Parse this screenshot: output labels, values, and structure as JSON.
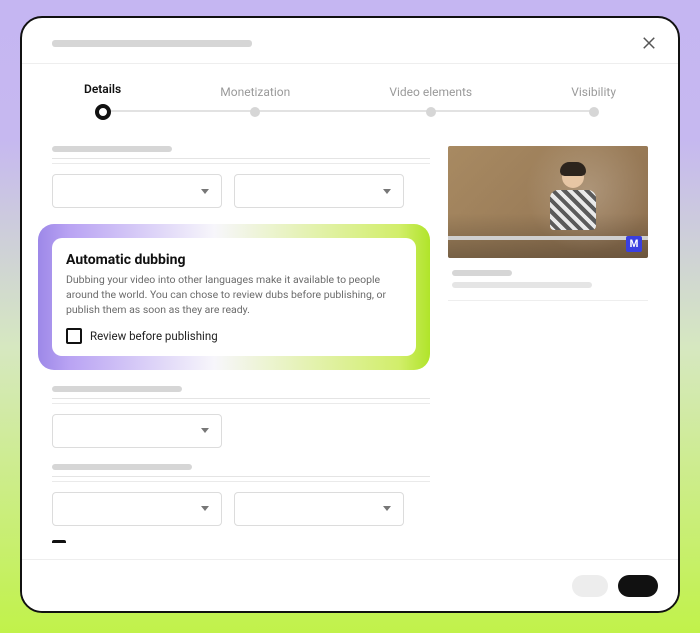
{
  "stepper": {
    "steps": [
      {
        "label": "Details",
        "active": true
      },
      {
        "label": "Monetization",
        "active": false
      },
      {
        "label": "Video elements",
        "active": false
      },
      {
        "label": "Visibility",
        "active": false
      }
    ]
  },
  "highlight": {
    "title": "Automatic dubbing",
    "description": "Dubbing your video into other languages make it available to people around the world. You can chose to review dubs before publishing, or publish them as soon as they are ready.",
    "checkbox_label": "Review before publishing",
    "checkbox_checked": false
  },
  "thumbnail": {
    "badge": "M"
  }
}
